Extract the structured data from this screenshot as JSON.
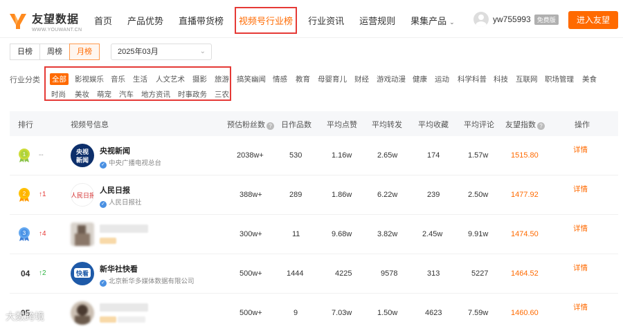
{
  "header": {
    "logo_title": "友望数据",
    "logo_sub": "WWW.YOUWANT.CN",
    "nav": [
      "首页",
      "产品优势",
      "直播带货榜",
      "视频号行业榜",
      "行业资讯",
      "运营规则",
      "果集产品"
    ],
    "username": "yw755993",
    "vip_badge": "免费版",
    "enter_button": "进入友望",
    "accent_color": "#ff6a00"
  },
  "filters": {
    "period_tabs": [
      "日榜",
      "周榜",
      "月榜"
    ],
    "active_period": "月榜",
    "date_value": "2025年03月"
  },
  "categories": {
    "label": "行业分类",
    "items": [
      "全部",
      "影视娱乐",
      "音乐",
      "生活",
      "人文艺术",
      "摄影",
      "旅游",
      "搞笑幽闻",
      "情感",
      "教育",
      "母婴育儿",
      "财经",
      "游戏动漫",
      "健康",
      "运动",
      "科学科普",
      "科技",
      "互联网",
      "职场管理",
      "美食",
      "时尚",
      "美妆",
      "萌宠",
      "汽车",
      "地方资讯",
      "时事政务",
      "三农"
    ],
    "active": "全部"
  },
  "table": {
    "headers": [
      "排行",
      "视频号信息",
      "预估粉丝数",
      "日作品数",
      "平均点赞",
      "平均转发",
      "平均收藏",
      "平均评论",
      "友望指数",
      "操作"
    ],
    "rows": [
      {
        "rank": "1",
        "trend": "--",
        "name": "央视新闻",
        "org": "中央广播电视总台",
        "fans": "2038w+",
        "works": "530",
        "likes": "1.16w",
        "shares": "2.65w",
        "favs": "174",
        "comments": "1.57w",
        "score": "1515.80",
        "action": "详情"
      },
      {
        "rank": "2",
        "trend": "↑1",
        "name": "人民日报",
        "org": "人民日报社",
        "fans": "388w+",
        "works": "289",
        "likes": "1.86w",
        "shares": "6.22w",
        "favs": "239",
        "comments": "2.50w",
        "score": "1477.92",
        "action": "详情"
      },
      {
        "rank": "3",
        "trend": "↑4",
        "name": "",
        "org": "",
        "fans": "300w+",
        "works": "11",
        "likes": "9.68w",
        "shares": "3.82w",
        "favs": "2.45w",
        "comments": "9.91w",
        "score": "1474.50",
        "action": "详情"
      },
      {
        "rank": "04",
        "trend": "↑2",
        "name": "新华社快看",
        "org": "北京新华多媒体数据有限公司",
        "fans": "500w+",
        "works": "1444",
        "likes": "4225",
        "shares": "9578",
        "favs": "313",
        "comments": "5227",
        "score": "1464.52",
        "action": "详情"
      },
      {
        "rank": "05",
        "trend": "",
        "name": "",
        "org": "",
        "fans": "500w+",
        "works": "9",
        "likes": "7.03w",
        "shares": "1.50w",
        "favs": "4623",
        "comments": "7.59w",
        "score": "1460.60",
        "action": "详情"
      }
    ]
  },
  "watermark": "大数跨境"
}
